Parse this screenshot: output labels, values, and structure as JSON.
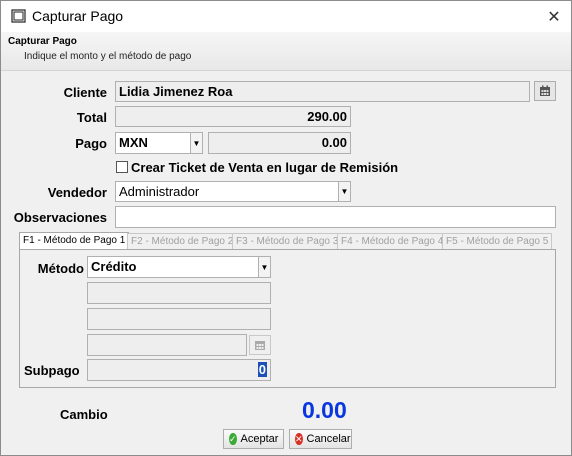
{
  "window": {
    "title": "Capturar Pago",
    "close_glyph": "✕"
  },
  "header": {
    "title": "Capturar Pago",
    "subtitle": "Indique el monto y el método de pago"
  },
  "form": {
    "cliente_label": "Cliente",
    "cliente_value": "Lidia Jimenez Roa",
    "total_label": "Total",
    "total_value": "290.00",
    "pago_label": "Pago",
    "moneda_value": "MXN",
    "pago_value": "0.00",
    "ticket_checkbox_label": "Crear Ticket de Venta en lugar de Remisión",
    "ticket_checked": false,
    "vendedor_label": "Vendedor",
    "vendedor_value": "Administrador",
    "observaciones_label": "Observaciones",
    "observaciones_value": ""
  },
  "tabs": [
    {
      "label": "F1 - Método de Pago 1",
      "active": true
    },
    {
      "label": "F2 - Método de Pago 2",
      "active": false
    },
    {
      "label": "F3 - Método de Pago 3",
      "active": false
    },
    {
      "label": "F4 - Método de Pago 4",
      "active": false
    },
    {
      "label": "F5 - Método de Pago 5",
      "active": false
    }
  ],
  "payment": {
    "metodo_label": "Método",
    "metodo_value": "Crédito",
    "extra1": "",
    "extra2": "",
    "extra3": "",
    "subpago_label": "Subpago",
    "subpago_value": "0"
  },
  "cambio": {
    "label": "Cambio",
    "value": "0.00"
  },
  "buttons": {
    "accept_label": "Aceptar",
    "cancel_label": "Cancelar"
  },
  "icons": {
    "app": "window-icon",
    "calendar": "calendar-icon",
    "accept": "check-circle-icon",
    "cancel": "x-circle-icon"
  },
  "colors": {
    "cambio": "#0a36e0",
    "accept_icon": "#3aaa35",
    "cancel_icon": "#d93025"
  }
}
